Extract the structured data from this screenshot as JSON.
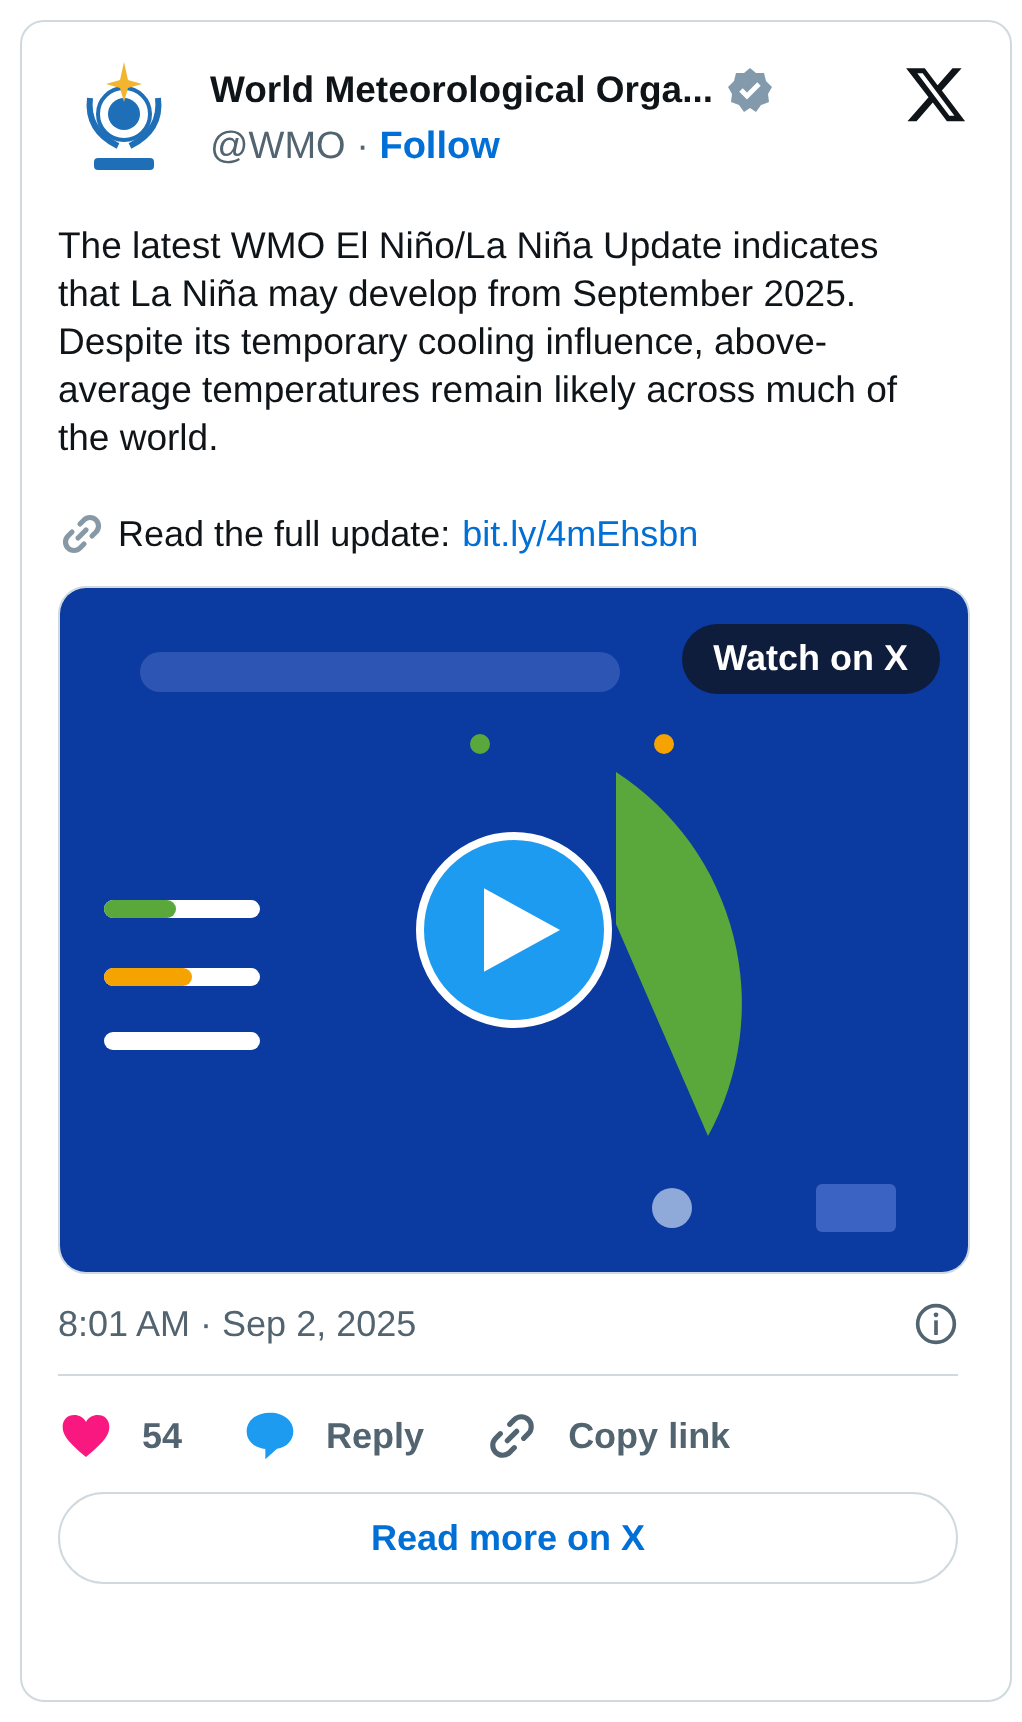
{
  "author": {
    "name": "World Meteorological Orga...",
    "verified": true,
    "handle": "@WMO",
    "separator": "·",
    "follow": "Follow"
  },
  "body": "The latest WMO El Niño/La Niña Update indicates that La Niña may develop from September 2025. Despite its temporary cooling influence, above-average temperatures remain likely across much of the world.",
  "link_line": {
    "prefix": "Read the full update:",
    "link": "bit.ly/4mEhsbn"
  },
  "media": {
    "kind": "picture",
    "badge": "Watch on X"
  },
  "timestamp": "8:01 AM · Sep 2, 2025",
  "actions": [
    {
      "kind": "like",
      "label": "54"
    },
    {
      "kind": "reply",
      "label": "Reply"
    },
    {
      "kind": "copy",
      "label": "Copy link"
    }
  ],
  "read_more": "Read more on X"
}
